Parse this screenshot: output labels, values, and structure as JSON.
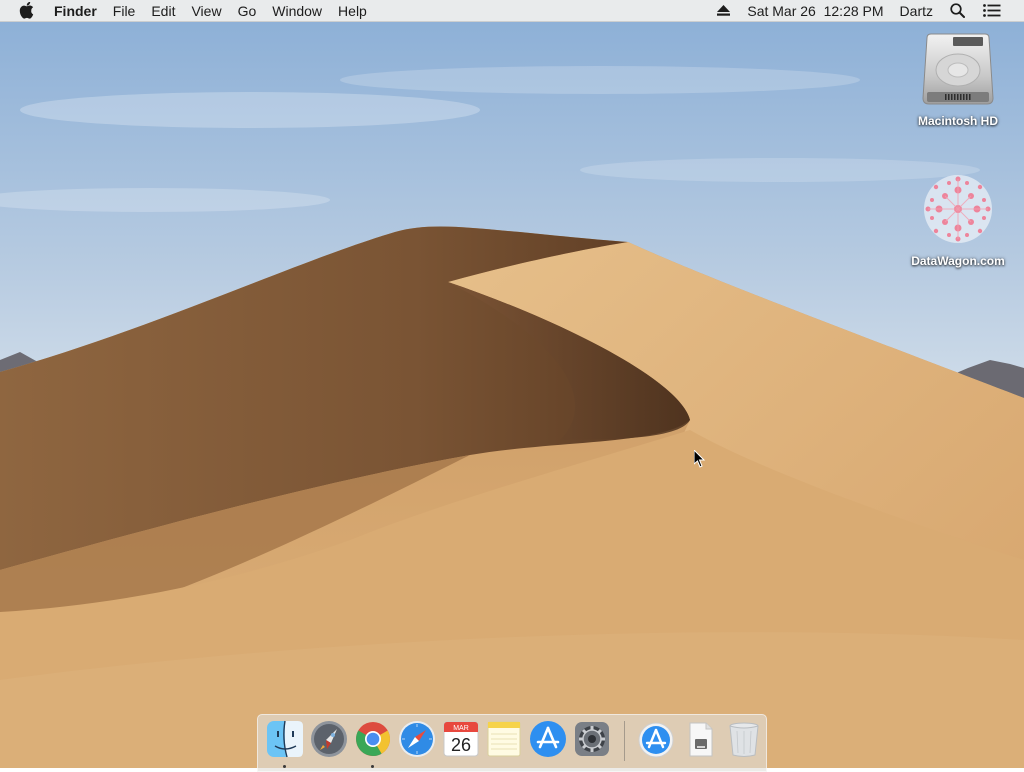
{
  "menubar": {
    "app_name": "Finder",
    "menus": [
      "File",
      "Edit",
      "View",
      "Go",
      "Window",
      "Help"
    ],
    "clock": "Sat Mar 26  12:28 PM",
    "user": "Dartz",
    "icons": [
      "apple-logo",
      "eject-icon",
      "spotlight-search-icon",
      "notification-center-icon"
    ]
  },
  "desktop": {
    "icons": [
      {
        "label": "Macintosh HD",
        "icon": "hard-drive-icon"
      },
      {
        "label": "DataWagon.com",
        "icon": "network-volume-icon"
      }
    ]
  },
  "dock": {
    "calendar_month": "MAR",
    "calendar_day": "26",
    "apps": [
      {
        "name": "Finder",
        "icon": "finder-icon",
        "running": true
      },
      {
        "name": "Launchpad",
        "icon": "launchpad-icon",
        "running": false
      },
      {
        "name": "Google Chrome",
        "icon": "chrome-icon",
        "running": true
      },
      {
        "name": "Safari",
        "icon": "safari-icon",
        "running": false
      },
      {
        "name": "Calendar",
        "icon": "calendar-icon",
        "running": false
      },
      {
        "name": "Notes",
        "icon": "notes-icon",
        "running": false
      },
      {
        "name": "App Store",
        "icon": "app-store-icon",
        "running": false
      },
      {
        "name": "System Preferences",
        "icon": "system-preferences-icon",
        "running": false
      }
    ],
    "stacks": [
      {
        "name": "Applications",
        "icon": "applications-folder-icon"
      },
      {
        "name": "Document",
        "icon": "document-stack-icon"
      },
      {
        "name": "Trash",
        "icon": "trash-icon"
      }
    ]
  },
  "colors": {
    "sky_top": "#8fb0d6",
    "sky_bottom": "#dfe8ee",
    "dune_light": "#d4a870",
    "dune_shadow": "#6e4a2c"
  }
}
